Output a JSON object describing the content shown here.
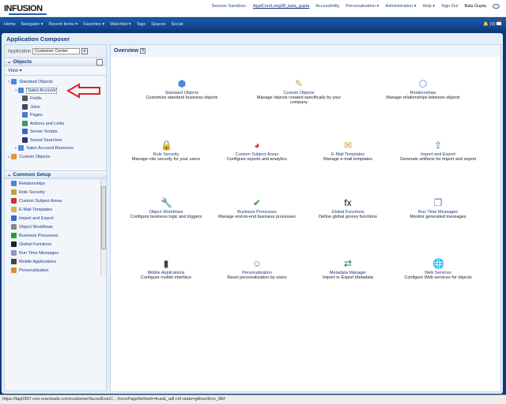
{
  "header": {
    "logo": "INFUSION",
    "session_label": "Session Sandbox:",
    "sandbox": "ApplCoreLong38_bala_gupta",
    "links": [
      "Accessibility",
      "Personalization ▾",
      "Administration ▾",
      "Help ▾",
      "Sign Out"
    ],
    "user": "Bala Gupta"
  },
  "nav": {
    "items": [
      "Home",
      "Navigator ▾",
      "Recent Items ▾",
      "Favorites ▾",
      "Watchlist ▾",
      "Tags",
      "Spaces",
      "Social"
    ],
    "notifications": "(0)"
  },
  "app": {
    "title": "Application Composer",
    "application_label": "Application",
    "application_value": "Customer Center"
  },
  "objects": {
    "title": "Objects",
    "view": "View ▾",
    "tree": [
      {
        "label": "Standard Objects",
        "level": 0,
        "color": "#4a8ad8"
      },
      {
        "label": "Sales Account",
        "level": 1,
        "color": "#4a8ad8",
        "selected": true
      },
      {
        "label": "Fields",
        "level": 2,
        "color": "#555"
      },
      {
        "label": "Joins",
        "level": 2,
        "color": "#446"
      },
      {
        "label": "Pages",
        "level": 2,
        "color": "#4a7ac8"
      },
      {
        "label": "Actions and Links",
        "level": 2,
        "color": "#3a9a6a"
      },
      {
        "label": "Server Scripts",
        "level": 2,
        "color": "#3a6ac8"
      },
      {
        "label": "Saved Searches",
        "level": 2,
        "color": "#336"
      },
      {
        "label": "Sales Account Resource",
        "level": 1,
        "color": "#4a8ad8"
      },
      {
        "label": "Custom Objects",
        "level": 0,
        "color": "#d89a3a"
      }
    ]
  },
  "common_setup": {
    "title": "Common Setup",
    "items": [
      {
        "label": "Relationships",
        "color": "#4a8ad8"
      },
      {
        "label": "Role Security",
        "color": "#c9a030"
      },
      {
        "label": "Custom Subject Areas",
        "color": "#c33"
      },
      {
        "label": "E-Mail Templates",
        "color": "#e0b050"
      },
      {
        "label": "Import and Export",
        "color": "#3a6ac8"
      },
      {
        "label": "Object Workflows",
        "color": "#888"
      },
      {
        "label": "Business Processes",
        "color": "#2aa02a"
      },
      {
        "label": "Global Functions",
        "color": "#222"
      },
      {
        "label": "Run Time Messages",
        "color": "#8a9ac8"
      },
      {
        "label": "Mobile Applications",
        "color": "#444"
      },
      {
        "label": "Personalization",
        "color": "#d8902a"
      }
    ]
  },
  "overview": {
    "title": "Overview",
    "help": "?",
    "tiles": [
      {
        "title": "Standard Objects",
        "desc": "Customize standard business objects",
        "icon": "cube-icon",
        "glyph": "⬢",
        "color": "#4a8ad8"
      },
      {
        "title": "Custom Objects",
        "desc": "Manage objects created specifically by your company",
        "icon": "cube-pencil-icon",
        "glyph": "✎",
        "color": "#d89a3a"
      },
      {
        "title": "Relationships",
        "desc": "Manage relationships between objects",
        "icon": "relationship-icon",
        "glyph": "⬡",
        "color": "#4a8ad8"
      },
      {
        "title": "Role Security",
        "desc": "Manage role security for your users",
        "icon": "lock-icon",
        "glyph": "🔒",
        "color": "#c9a030"
      },
      {
        "title": "Custom Subject Areas",
        "desc": "Configure reports and analytics",
        "icon": "chart-icon",
        "glyph": "◕",
        "color": "#c33"
      },
      {
        "title": "E-Mail Templates",
        "desc": "Manage e-mail templates",
        "icon": "envelope-icon",
        "glyph": "✉",
        "color": "#d8a040"
      },
      {
        "title": "Import and Export",
        "desc": "Generate artifacts for import and export",
        "icon": "upload-icon",
        "glyph": "⇪",
        "color": "#3a6ac8"
      },
      {
        "title": "Object Workflows",
        "desc": "Configure business logic and triggers",
        "icon": "wrench-icon",
        "glyph": "🔧",
        "color": "#888"
      },
      {
        "title": "Business Processes",
        "desc": "Manage end-to-end business processes",
        "icon": "checkmark-icon",
        "glyph": "✔",
        "color": "#2aa02a"
      },
      {
        "title": "Global Functions",
        "desc": "Define global groovy functions",
        "icon": "function-icon",
        "glyph": "fx",
        "color": "#111"
      },
      {
        "title": "Run Time Messages",
        "desc": "Monitor generated messages",
        "icon": "documents-icon",
        "glyph": "❐",
        "color": "#6a7ab8"
      },
      {
        "title": "Mobile Applications",
        "desc": "Configure mobile interface",
        "icon": "mobile-icon",
        "glyph": "▮",
        "color": "#444"
      },
      {
        "title": "Personalization",
        "desc": "Reset personalization by users",
        "icon": "user-pencil-icon",
        "glyph": "☺",
        "color": "#4a8ad8"
      },
      {
        "title": "Metadata Manager",
        "desc": "Import or Export Metadata",
        "icon": "metadata-icon",
        "glyph": "⇄",
        "color": "#2a7a4a"
      },
      {
        "title": "Web Services",
        "desc": "Configure Web services for objects",
        "icon": "globe-icon",
        "glyph": "🌐",
        "color": "#2a6ac8"
      }
    ]
  },
  "status_bar": "https://fap0397-crm.oracleads.com/customer/faces/ExtnC...;forcePageRefresh=true&_adf.ctrl-state=gkbssr9cm_88#"
}
